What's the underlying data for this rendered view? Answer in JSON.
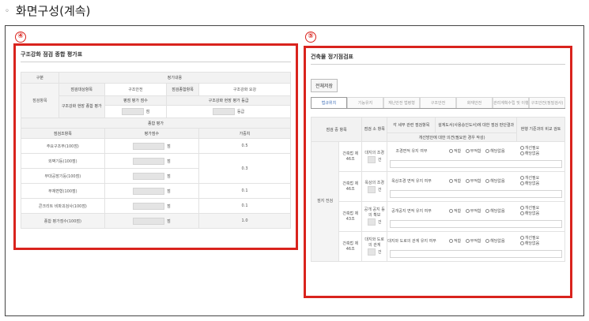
{
  "heading": {
    "bullet": "◦",
    "text": "화면구성(계속)"
  },
  "panel4": {
    "badge": "④",
    "title": "구조강화 점검 종합 평가표",
    "section_header": "구분",
    "section_value": "정기내용",
    "group_label": "점검항목",
    "row1": {
      "label1": "점검대상항목",
      "value1": "구조안전",
      "label2": "점검종합항목",
      "value2": "구조강화 요강"
    },
    "row2": {
      "label": "구조강화 현장 종합 평가",
      "col1": "평점 평가 점수",
      "col2": "구조강화 현장 평가 등급"
    },
    "row3": {
      "unit1": "점",
      "unit2": "등급"
    },
    "composite_header": "종합 평가",
    "col_headers": {
      "item": "점검조항목",
      "score": "평가점수",
      "weight": "가중치"
    },
    "items": [
      {
        "name": "주요구조부(100점)",
        "unit": "점",
        "weight": "0.5"
      },
      {
        "name": "외벽기둥(100점)",
        "unit": "점",
        "weight": ""
      },
      {
        "name": "부대공장기둥(100점)",
        "unit": "점",
        "weight": "0.3"
      },
      {
        "name": "부재변형(100점)",
        "unit": "점",
        "weight": "0.1"
      },
      {
        "name": "콘크리트 비파괴검사(100점)",
        "unit": "점",
        "weight": "0.1"
      }
    ],
    "total": {
      "name": "종합 평가점수(100점)",
      "unit": "점",
      "weight": "1.0"
    }
  },
  "panel5": {
    "badge": "⑤",
    "title": "건축물 정기점검표",
    "save_all": "전체저장",
    "tabs": [
      "법규위치",
      "기능유지",
      "재난안전 법령형",
      "구조안전",
      "화재안전",
      "관리계획수립 및 이행",
      "구조안전(정밀검사)"
    ],
    "headers": {
      "c1": "점검 중 항목",
      "c2": "점검 소 항목",
      "c3": "각 세부 관련 점검항목",
      "c4": "설계도서(사용승인도서)에 대한 점검 판단결과",
      "c5": "현행 기준과의 비교 검토",
      "sub": "개선방안에 대한 의견(필요한 경우 작성)"
    },
    "left_group": "점지 전검",
    "rows": [
      {
        "cat": "건축법 제46조",
        "sub": "대지의 조경",
        "detail": "조경면적 유지 여부",
        "opt1": "적합",
        "opt2": "부적합",
        "opt3": "해당없음",
        "cmp1": "개선필요",
        "cmp2": "해당없음"
      },
      {
        "cat": "건축법 제46조",
        "sub": "옥상의 조경",
        "detail": "옥상조경 면적 유지 여부",
        "opt1": "적합",
        "opt2": "부적합",
        "opt3": "해당없음",
        "cmp1": "개선필요",
        "cmp2": "해당없음"
      },
      {
        "cat": "건축법 제43조",
        "sub": "공개 공지 등의 확보",
        "detail": "공개공지 면적 유지 여부",
        "opt1": "적합",
        "opt2": "부적합",
        "opt3": "해당없음",
        "cmp1": "개선필요",
        "cmp2": "해당없음"
      },
      {
        "cat": "건축법 제46조",
        "sub": "대지와 도로의 관계",
        "detail": "대지와 도로의 관계 유지 여부",
        "opt1": "적합",
        "opt2": "부적합",
        "opt3": "해당없음",
        "cmp1": "개선필요",
        "cmp2": "해당없음"
      }
    ],
    "unit": "건"
  },
  "colors": {
    "highlight": "#d9231d",
    "active_tab": "#3f6fb8"
  }
}
